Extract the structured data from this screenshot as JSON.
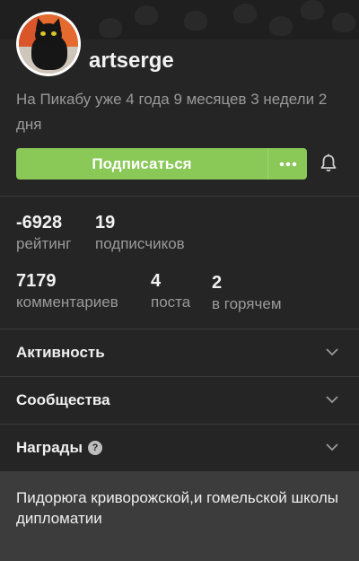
{
  "profile": {
    "username": "artserge",
    "since": "На Пикабу уже 4 года 9 месяцев 3 недели 2 дня",
    "subscribe_label": "Подписаться",
    "more_label": "•••",
    "stats_row1": [
      {
        "value": "-6928",
        "label": "рейтинг"
      },
      {
        "value": "19",
        "label": "подписчиков"
      }
    ],
    "stats_row2": [
      {
        "value": "7179",
        "label": "комментариев"
      },
      {
        "value": "4",
        "label": "поста"
      },
      {
        "value": "2",
        "label": "в горячем"
      }
    ],
    "sections": [
      {
        "title": "Активность"
      },
      {
        "title": "Сообщества"
      },
      {
        "title": "Награды",
        "help": "?"
      }
    ],
    "description": "Пидорюга криворожской,и гомельской школы дипломатии"
  },
  "colors": {
    "accent": "#8ac858",
    "background": "#252525",
    "footer_background": "#3c3c3c"
  },
  "icons": [
    "bell-icon",
    "more-icon",
    "chevron-down-icon",
    "help-icon"
  ]
}
